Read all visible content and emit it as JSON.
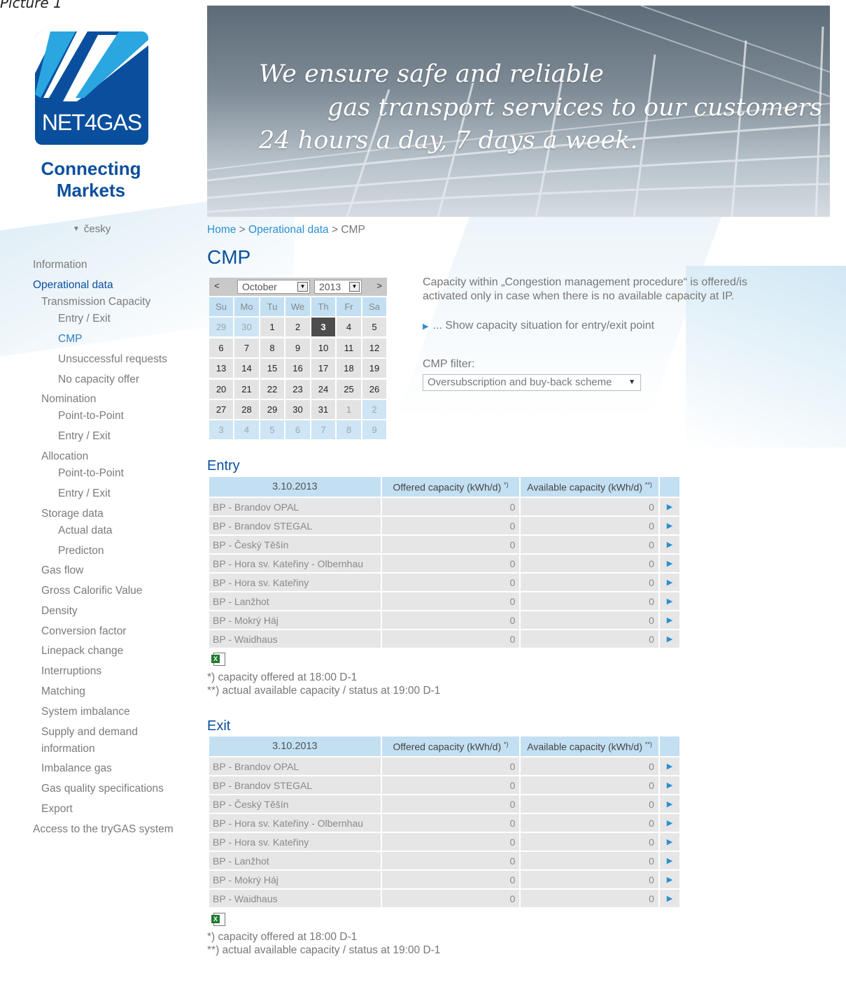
{
  "picture_label": "Picture 1",
  "logo": {
    "text": "NET4GAS",
    "tagline_line1": "Connecting",
    "tagline_line2": "Markets"
  },
  "language": "česky",
  "sidebar": [
    {
      "label": "Information",
      "level": 0
    },
    {
      "label": "Operational data",
      "level": 0,
      "state": "active"
    },
    {
      "label": "Transmission Capacity",
      "level": 1
    },
    {
      "label": "Entry / Exit",
      "level": 2
    },
    {
      "label": "CMP",
      "level": 2,
      "state": "current"
    },
    {
      "label": "Unsuccessful requests",
      "level": 2
    },
    {
      "label": "No capacity offer",
      "level": 2
    },
    {
      "label": "Nomination",
      "level": 1
    },
    {
      "label": "Point-to-Point",
      "level": 2
    },
    {
      "label": "Entry / Exit",
      "level": 2
    },
    {
      "label": "Allocation",
      "level": 1
    },
    {
      "label": "Point-to-Point",
      "level": 2
    },
    {
      "label": "Entry / Exit",
      "level": 2
    },
    {
      "label": "Storage data",
      "level": 1
    },
    {
      "label": "Actual data",
      "level": 2
    },
    {
      "label": "Predicton",
      "level": 2
    },
    {
      "label": "Gas flow",
      "level": 1
    },
    {
      "label": "Gross Calorific Value",
      "level": 1
    },
    {
      "label": "Density",
      "level": 1
    },
    {
      "label": "Conversion factor",
      "level": 1
    },
    {
      "label": "Linepack change",
      "level": 1
    },
    {
      "label": "Interruptions",
      "level": 1
    },
    {
      "label": "Matching",
      "level": 1
    },
    {
      "label": "System imbalance",
      "level": 1
    },
    {
      "label": "Supply and demand",
      "level": 1
    },
    {
      "label": "information",
      "level": 1
    },
    {
      "label": "Imbalance gas",
      "level": 1
    },
    {
      "label": "Gas quality specifications",
      "level": 1
    },
    {
      "label": "Export",
      "level": 1
    },
    {
      "label": "Access to the tryGAS system",
      "level": 0
    }
  ],
  "banner": {
    "line1": "We ensure safe and reliable",
    "line2": "gas transport services to our customers",
    "line3": "24 hours a day, 7 days a week."
  },
  "breadcrumb": {
    "home": "Home",
    "sep1": ">",
    "section": "Operational data",
    "sep2": ">",
    "current": "CMP"
  },
  "page_title": "CMP",
  "calendar": {
    "prev": "<",
    "next": ">",
    "month": "October",
    "year": "2013",
    "weekdays": [
      "Su",
      "Mo",
      "Tu",
      "We",
      "Th",
      "Fr",
      "Sa"
    ],
    "days": [
      {
        "d": "29",
        "t": "prev"
      },
      {
        "d": "30",
        "t": "prev"
      },
      {
        "d": "1"
      },
      {
        "d": "2"
      },
      {
        "d": "3",
        "t": "sel"
      },
      {
        "d": "4"
      },
      {
        "d": "5"
      },
      {
        "d": "6"
      },
      {
        "d": "7"
      },
      {
        "d": "8"
      },
      {
        "d": "9"
      },
      {
        "d": "10"
      },
      {
        "d": "11"
      },
      {
        "d": "12"
      },
      {
        "d": "13"
      },
      {
        "d": "14"
      },
      {
        "d": "15"
      },
      {
        "d": "16"
      },
      {
        "d": "17"
      },
      {
        "d": "18"
      },
      {
        "d": "19"
      },
      {
        "d": "20"
      },
      {
        "d": "21"
      },
      {
        "d": "22"
      },
      {
        "d": "23"
      },
      {
        "d": "24"
      },
      {
        "d": "25"
      },
      {
        "d": "26"
      },
      {
        "d": "27"
      },
      {
        "d": "28"
      },
      {
        "d": "29"
      },
      {
        "d": "30"
      },
      {
        "d": "31"
      },
      {
        "d": "1",
        "t": "next"
      },
      {
        "d": "2",
        "t": "next"
      },
      {
        "d": "3",
        "t": "next"
      },
      {
        "d": "4",
        "t": "next"
      },
      {
        "d": "5",
        "t": "next"
      },
      {
        "d": "6",
        "t": "next"
      },
      {
        "d": "7",
        "t": "next"
      },
      {
        "d": "8",
        "t": "next"
      },
      {
        "d": "9",
        "t": "next"
      }
    ]
  },
  "info_text": "Capacity within „Congestion management procedure“ is offered/is activated only in case when there is no available capacity at IP.",
  "show_link": "... Show capacity situation for entry/exit point",
  "filter": {
    "label": "CMP filter:",
    "value": "Oversubscription and buy-back scheme"
  },
  "entry": {
    "title": "Entry",
    "date": "3.10.2013",
    "col_offered": "Offered capacity (kWh/d)",
    "col_offered_mark": "*)",
    "col_available": "Available capacity (kWh/d)",
    "col_available_mark": "**)",
    "rows": [
      {
        "name": "BP - Brandov OPAL",
        "offered": "0",
        "available": "0"
      },
      {
        "name": "BP - Brandov STEGAL",
        "offered": "0",
        "available": "0"
      },
      {
        "name": "BP - Český Těšín",
        "offered": "0",
        "available": "0"
      },
      {
        "name": "BP - Hora sv. Kateřiny - Olbernhau",
        "offered": "0",
        "available": "0"
      },
      {
        "name": "BP - Hora sv. Kateřiny",
        "offered": "0",
        "available": "0"
      },
      {
        "name": "BP - Lanžhot",
        "offered": "0",
        "available": "0"
      },
      {
        "name": "BP - Mokrý Háj",
        "offered": "0",
        "available": "0"
      },
      {
        "name": "BP - Waidhaus",
        "offered": "0",
        "available": "0"
      }
    ],
    "note1": "*) capacity offered at 18:00 D-1",
    "note2": "**) actual available capacity / status at 19:00 D-1"
  },
  "exit": {
    "title": "Exit",
    "date": "3.10.2013",
    "col_offered": "Offered capacity (kWh/d)",
    "col_offered_mark": "*)",
    "col_available": "Available capacity (kWh/d)",
    "col_available_mark": "**)",
    "rows": [
      {
        "name": "BP - Brandov OPAL",
        "offered": "0",
        "available": "0"
      },
      {
        "name": "BP - Brandov STEGAL",
        "offered": "0",
        "available": "0"
      },
      {
        "name": "BP - Český Těšín",
        "offered": "0",
        "available": "0"
      },
      {
        "name": "BP - Hora sv. Kateřiny - Olbernhau",
        "offered": "0",
        "available": "0"
      },
      {
        "name": "BP - Hora sv. Kateřiny",
        "offered": "0",
        "available": "0"
      },
      {
        "name": "BP - Lanžhot",
        "offered": "0",
        "available": "0"
      },
      {
        "name": "BP - Mokrý Háj",
        "offered": "0",
        "available": "0"
      },
      {
        "name": "BP - Waidhaus",
        "offered": "0",
        "available": "0"
      }
    ],
    "note1": "*) capacity offered at 18:00 D-1",
    "note2": "**) actual available capacity / status at 19:00 D-1"
  },
  "colors": {
    "brand_blue": "#0a4f9d",
    "link_blue": "#2a8fd0",
    "header_cell": "#c3e0f3",
    "data_cell": "#e6e6e6"
  }
}
